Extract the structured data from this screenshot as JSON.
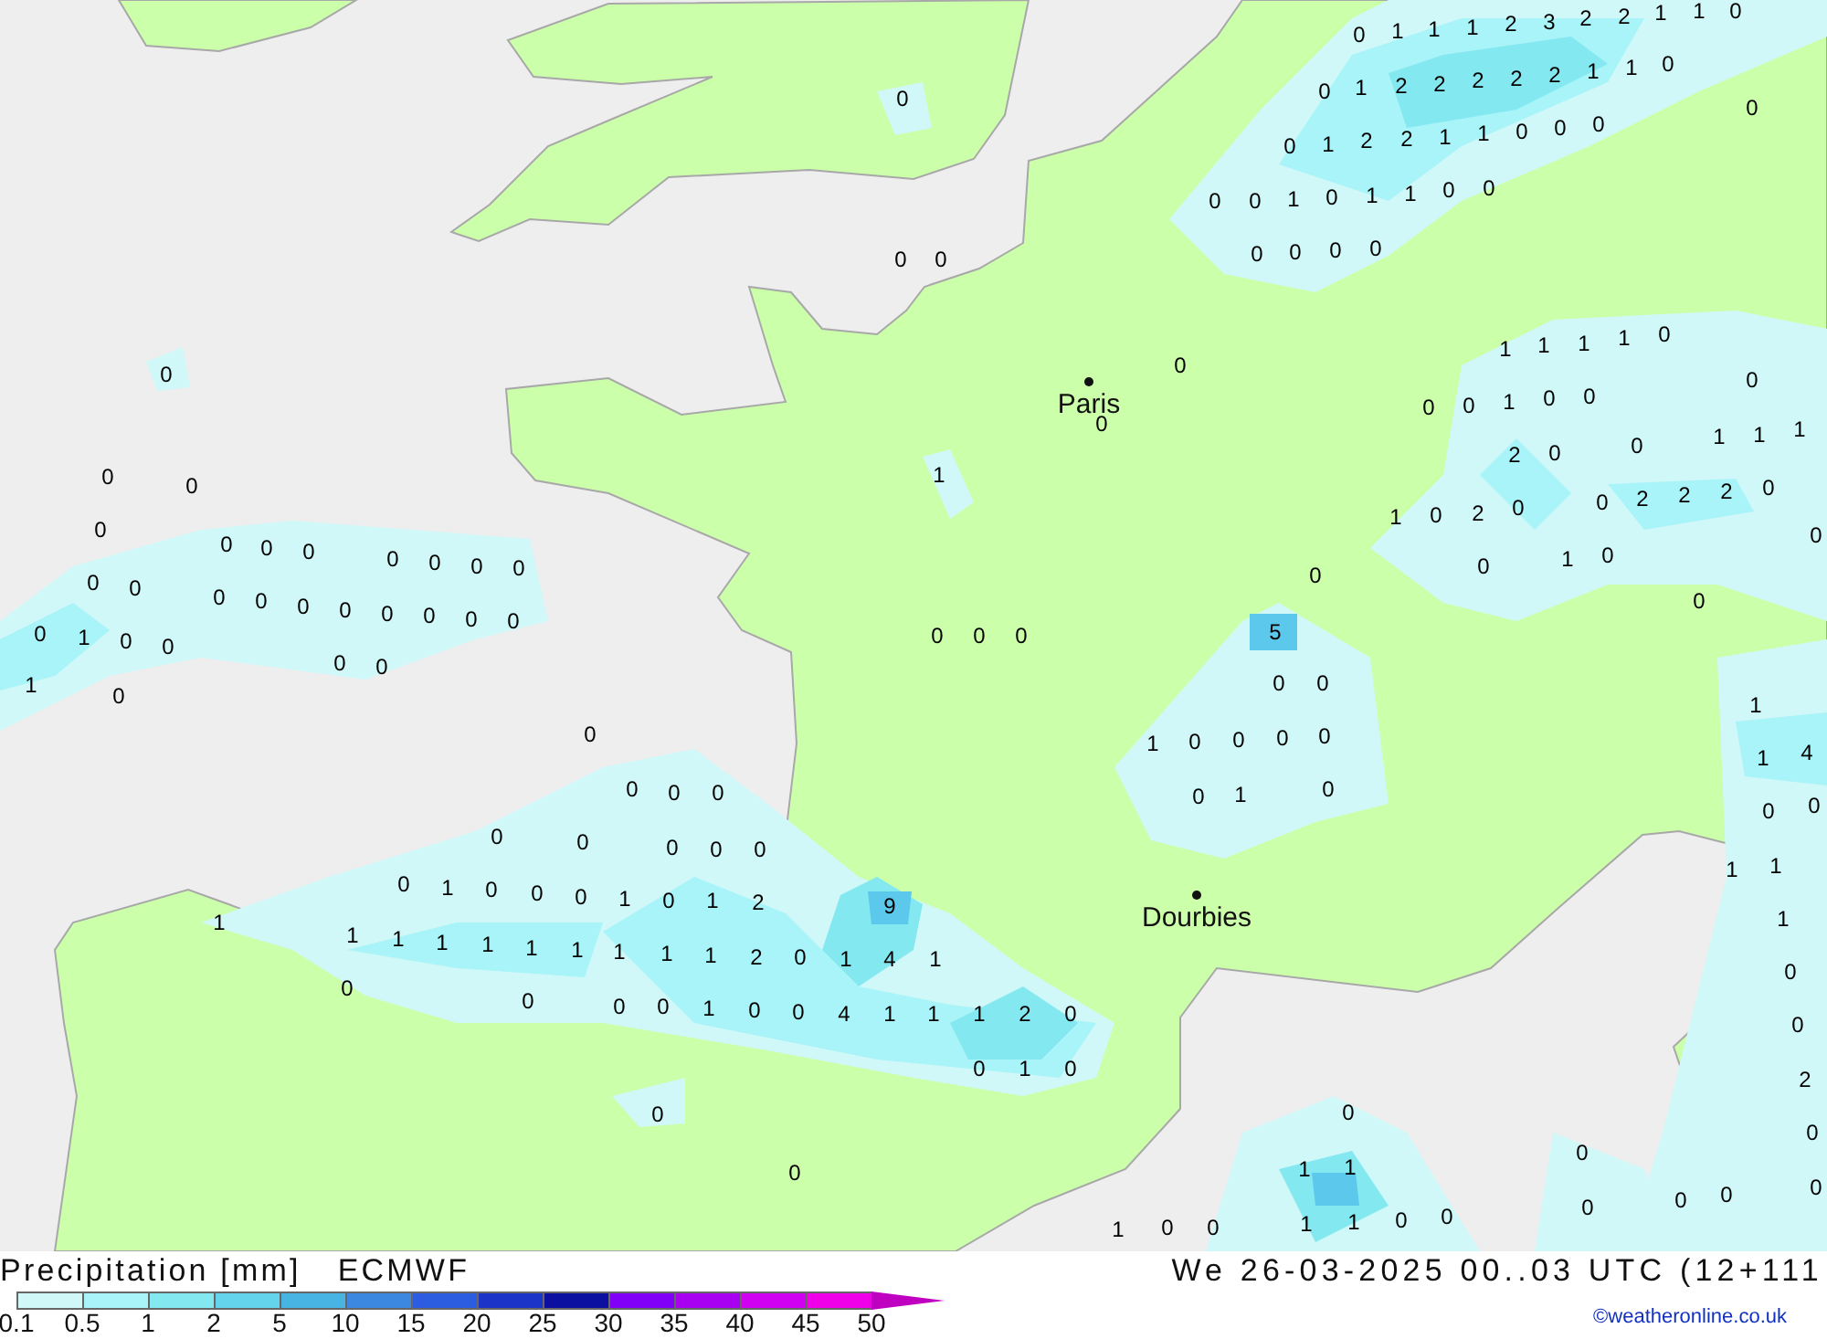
{
  "map": {
    "grid_values": [
      "0",
      "1",
      "1",
      "1",
      "2",
      "3",
      "2",
      "2",
      "1",
      "1",
      "0",
      "0",
      "1",
      "2",
      "2",
      "2",
      "2",
      "2",
      "1",
      "1",
      "0",
      "0",
      "0",
      "1",
      "2",
      "2",
      "1",
      "1",
      "0",
      "0",
      "0",
      "0",
      "0",
      "1",
      "0",
      "1",
      "1",
      "0",
      "0",
      "0",
      "0",
      "0",
      "0",
      "1",
      "1",
      "1",
      "1",
      "0",
      "0",
      "0",
      "0",
      "1",
      "0",
      "0",
      "1",
      "1",
      "1",
      "2",
      "0",
      "0",
      "0",
      "2",
      "2",
      "2",
      "0",
      "1",
      "0",
      "2",
      "0",
      "0",
      "0",
      "1",
      "0",
      "0",
      "0",
      "5",
      "0",
      "0",
      "0",
      "0",
      "1",
      "0",
      "0",
      "0",
      "0",
      "0",
      "0",
      "0",
      "0",
      "0",
      "0",
      "0",
      "0",
      "0",
      "0",
      "0",
      "0",
      "0",
      "0",
      "0",
      "0",
      "0",
      "0",
      "0",
      "1",
      "0",
      "0",
      "1",
      "0",
      "0",
      "0",
      "0",
      "0",
      "0",
      "0",
      "1",
      "0",
      "0",
      "0",
      "1",
      "1",
      "1",
      "1",
      "1",
      "1",
      "1",
      "0",
      "0",
      "0",
      "0",
      "0",
      "1",
      "0",
      "0",
      "0",
      "0",
      "0",
      "1",
      "0",
      "0",
      "0",
      "0",
      "0",
      "0",
      "0",
      "0",
      "0",
      "1",
      "0",
      "1",
      "2",
      "9",
      "1",
      "1",
      "1",
      "2",
      "0",
      "1",
      "4",
      "1",
      "0",
      "0",
      "1",
      "0",
      "0",
      "4",
      "1",
      "1",
      "1",
      "2",
      "0",
      "0",
      "1",
      "0",
      "0",
      "0",
      "1",
      "0",
      "0",
      "1",
      "1",
      "4",
      "0",
      "0",
      "1",
      "1",
      "1",
      "0",
      "0",
      "2",
      "0",
      "0",
      "0",
      "0",
      "0",
      "0",
      "0",
      "1",
      "1",
      "1",
      "1",
      "0",
      "0"
    ],
    "cities": [
      {
        "name": "Paris"
      },
      {
        "name": "Dourbies"
      }
    ]
  },
  "legend": {
    "title": "Precipitation [mm]",
    "model": "ECMWF",
    "valid_time": "We 26-03-2025 00..03 UTC (12+111",
    "scale": [
      {
        "label": "0.1",
        "color": "#d0f8f8",
        "kind": "box"
      },
      {
        "label": "0.5",
        "color": "#a8f4f8",
        "kind": "box"
      },
      {
        "label": "1",
        "color": "#84e8f0",
        "kind": "box"
      },
      {
        "label": "2",
        "color": "#64d4ec",
        "kind": "box"
      },
      {
        "label": "5",
        "color": "#48b4e4",
        "kind": "box"
      },
      {
        "label": "10",
        "color": "#3c88e0",
        "kind": "box"
      },
      {
        "label": "15",
        "color": "#2c5ce0",
        "kind": "box"
      },
      {
        "label": "20",
        "color": "#1c34c8",
        "kind": "box"
      },
      {
        "label": "25",
        "color": "#0c10a0",
        "kind": "box"
      },
      {
        "label": "30",
        "color": "#8000f8",
        "kind": "box"
      },
      {
        "label": "35",
        "color": "#a800f0",
        "kind": "box"
      },
      {
        "label": "40",
        "color": "#d000f0",
        "kind": "box"
      },
      {
        "label": "45",
        "color": "#f000e8",
        "kind": "box"
      },
      {
        "label": "50",
        "color": "#c000c0",
        "kind": "arrow"
      }
    ],
    "credit": "©weatheronline.co.uk"
  }
}
